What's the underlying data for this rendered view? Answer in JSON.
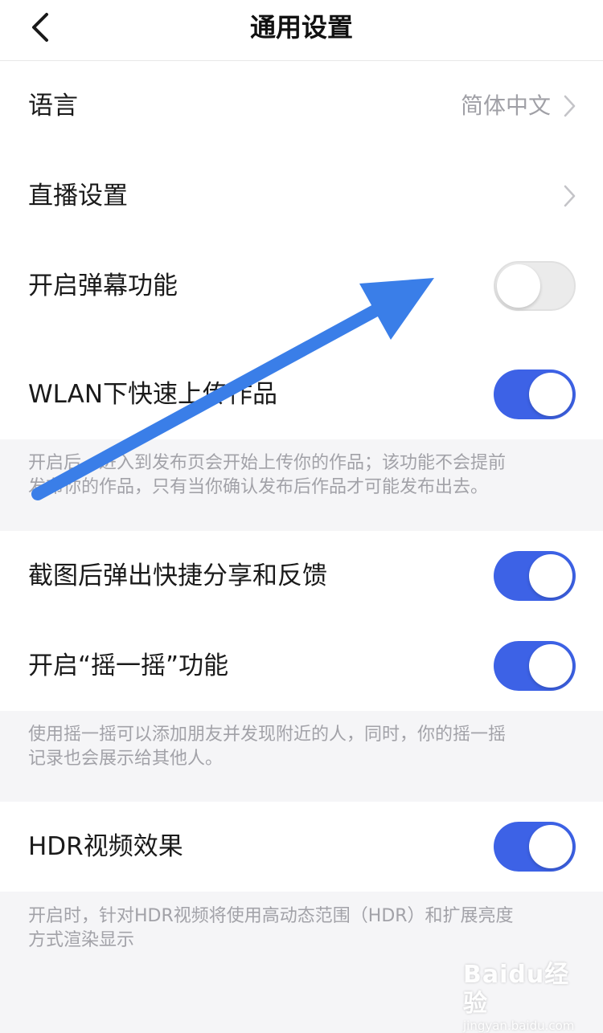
{
  "header": {
    "title": "通用设置",
    "back_icon": "chevron-left-icon"
  },
  "settings": {
    "language": {
      "label": "语言",
      "value": "简体中文"
    },
    "live": {
      "label": "直播设置"
    },
    "danmaku": {
      "label": "开启弹幕功能",
      "enabled": false
    },
    "wlan_upload": {
      "label": "WLAN下快速上传作品",
      "enabled": true,
      "note_line1": "开启后，进入到发布页会开始上传你的作品；该功能不会提前",
      "note_line2": "发布你的作品，只有当你确认发布后作品才可能发布出去。"
    },
    "screenshot_share": {
      "label": "截图后弹出快捷分享和反馈",
      "enabled": true
    },
    "shake": {
      "label": "开启“摇一摇”功能",
      "enabled": true,
      "note_line1": "使用摇一摇可以添加朋友并发现附近的人，同时，你的摇一摇",
      "note_line2": "记录也会展示给其他人。"
    },
    "hdr": {
      "label": "HDR视频效果",
      "enabled": true,
      "note_line1": "开启时，针对HDR视频将使用高动态范围（HDR）和扩展亮度",
      "note_line2": "方式渲染显示"
    }
  },
  "watermark": {
    "text": "Baidu经验",
    "url": "jingyan.baidu.com"
  },
  "colors": {
    "accent": "#3d62e6",
    "arrow": "#3a7ee8",
    "background": "#f5f5f7"
  }
}
